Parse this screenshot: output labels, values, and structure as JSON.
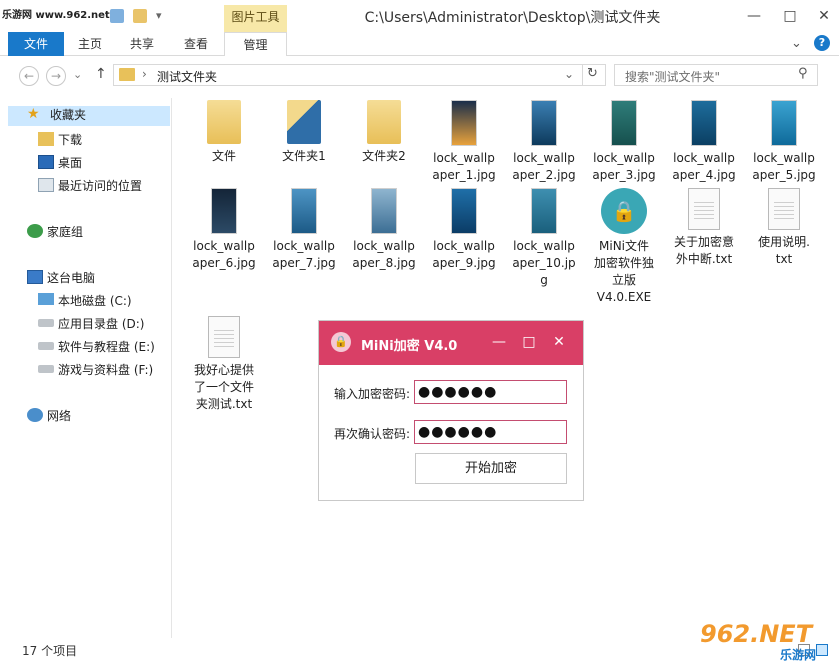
{
  "watermark": "乐游网 www.962.net",
  "window": {
    "context_tab": "图片工具",
    "title": "C:\\Users\\Administrator\\Desktop\\测试文件夹",
    "minimize": "—",
    "maximize": "□",
    "close": "✕"
  },
  "ribbon": {
    "tabs": [
      "文件",
      "主页",
      "共享",
      "查看",
      "管理"
    ],
    "collapse_glyph": "⌄",
    "help_glyph": "?"
  },
  "nav": {
    "back": "←",
    "forward": "→",
    "recent": "⌄",
    "up": "↑",
    "breadcrumb_sep": "›",
    "breadcrumb": "测试文件夹",
    "addr_dropdown": "⌄",
    "refresh": "↻",
    "search_placeholder": "搜索\"测试文件夹\"",
    "search_glyph": "⚲"
  },
  "sidebar": {
    "items": [
      {
        "label": "收藏夹",
        "icon": "star-icon"
      },
      {
        "label": "下载",
        "icon": "download-folder-icon"
      },
      {
        "label": "桌面",
        "icon": "desktop-icon"
      },
      {
        "label": "最近访问的位置",
        "icon": "recent-places-icon"
      },
      {
        "label": "家庭组",
        "icon": "homegroup-icon"
      },
      {
        "label": "这台电脑",
        "icon": "computer-icon"
      },
      {
        "label": "本地磁盘 (C:)",
        "icon": "drive-c-icon"
      },
      {
        "label": "应用目录盘 (D:)",
        "icon": "drive-icon"
      },
      {
        "label": "软件与教程盘 (E:)",
        "icon": "drive-icon"
      },
      {
        "label": "游戏与资料盘 (F:)",
        "icon": "drive-icon"
      },
      {
        "label": "网络",
        "icon": "network-icon"
      }
    ]
  },
  "files": [
    {
      "name": "文件",
      "kind": "folder"
    },
    {
      "name": "文件夹1",
      "kind": "folder-blue"
    },
    {
      "name": "文件夹2",
      "kind": "folder"
    },
    {
      "name": "lock_wallpaper_1.jpg",
      "kind": "image",
      "colors": [
        "#1a2e4a",
        "#e8a23c"
      ]
    },
    {
      "name": "lock_wallpaper_2.jpg",
      "kind": "image",
      "colors": [
        "#3b7fb3",
        "#0d3a5c"
      ]
    },
    {
      "name": "lock_wallpaper_3.jpg",
      "kind": "image",
      "colors": [
        "#2f7d7a",
        "#16504e"
      ]
    },
    {
      "name": "lock_wallpaper_4.jpg",
      "kind": "image",
      "colors": [
        "#1e6d9c",
        "#0b3f63"
      ]
    },
    {
      "name": "lock_wallpaper_5.jpg",
      "kind": "image",
      "colors": [
        "#3ba3d1",
        "#0f6a9a"
      ]
    },
    {
      "name": "lock_wallpaper_6.jpg",
      "kind": "image",
      "colors": [
        "#142538",
        "#2c4a66"
      ]
    },
    {
      "name": "lock_wallpaper_7.jpg",
      "kind": "image",
      "colors": [
        "#4d94c4",
        "#1c5a86"
      ]
    },
    {
      "name": "lock_wallpaper_8.jpg",
      "kind": "image",
      "colors": [
        "#8fb5cf",
        "#3c6e94"
      ]
    },
    {
      "name": "lock_wallpaper_9.jpg",
      "kind": "image",
      "colors": [
        "#1f6fa8",
        "#0b3c66"
      ]
    },
    {
      "name": "lock_wallpaper_10.jpg",
      "kind": "image",
      "colors": [
        "#3e8fb0",
        "#1a5f7c"
      ]
    },
    {
      "name": "MiNi文件加密软件独立版V4.0.EXE",
      "kind": "app"
    },
    {
      "name": "关于加密意外中断.txt",
      "kind": "doc"
    },
    {
      "name": "使用说明.txt",
      "kind": "doc"
    },
    {
      "name": "我好心提供了一个文件夹测试.txt",
      "kind": "doc"
    }
  ],
  "file_labels": [
    "文件",
    "文件夹1",
    "文件夹2",
    "lock_wallp\naper_1.jpg",
    "lock_wallp\naper_2.jpg",
    "lock_wallp\naper_3.jpg",
    "lock_wallp\naper_4.jpg",
    "lock_wallp\naper_5.jpg",
    "lock_wallp\naper_6.jpg",
    "lock_wallp\naper_7.jpg",
    "lock_wallp\naper_8.jpg",
    "lock_wallp\naper_9.jpg",
    "lock_wallp\naper_10.jp\ng",
    "MiNi文件\n加密软件独\n立版\nV4.0.EXE",
    "关于加密意\n外中断.txt",
    "使用说明.\ntxt",
    "我好心提供\n了一个文件\n夹测试.txt"
  ],
  "status": "17 个项目",
  "dialog": {
    "title": "MiNi加密 V4.0",
    "minimize": "—",
    "maximize": "□",
    "close": "✕",
    "password_label": "输入加密密码:",
    "password_value": "●●●●●●",
    "confirm_label": "再次确认密码:",
    "confirm_value": "●●●●●●",
    "submit": "开始加密",
    "accent": "#d93f66"
  },
  "logo": {
    "main": "962.NET",
    "sub": "乐游网"
  }
}
